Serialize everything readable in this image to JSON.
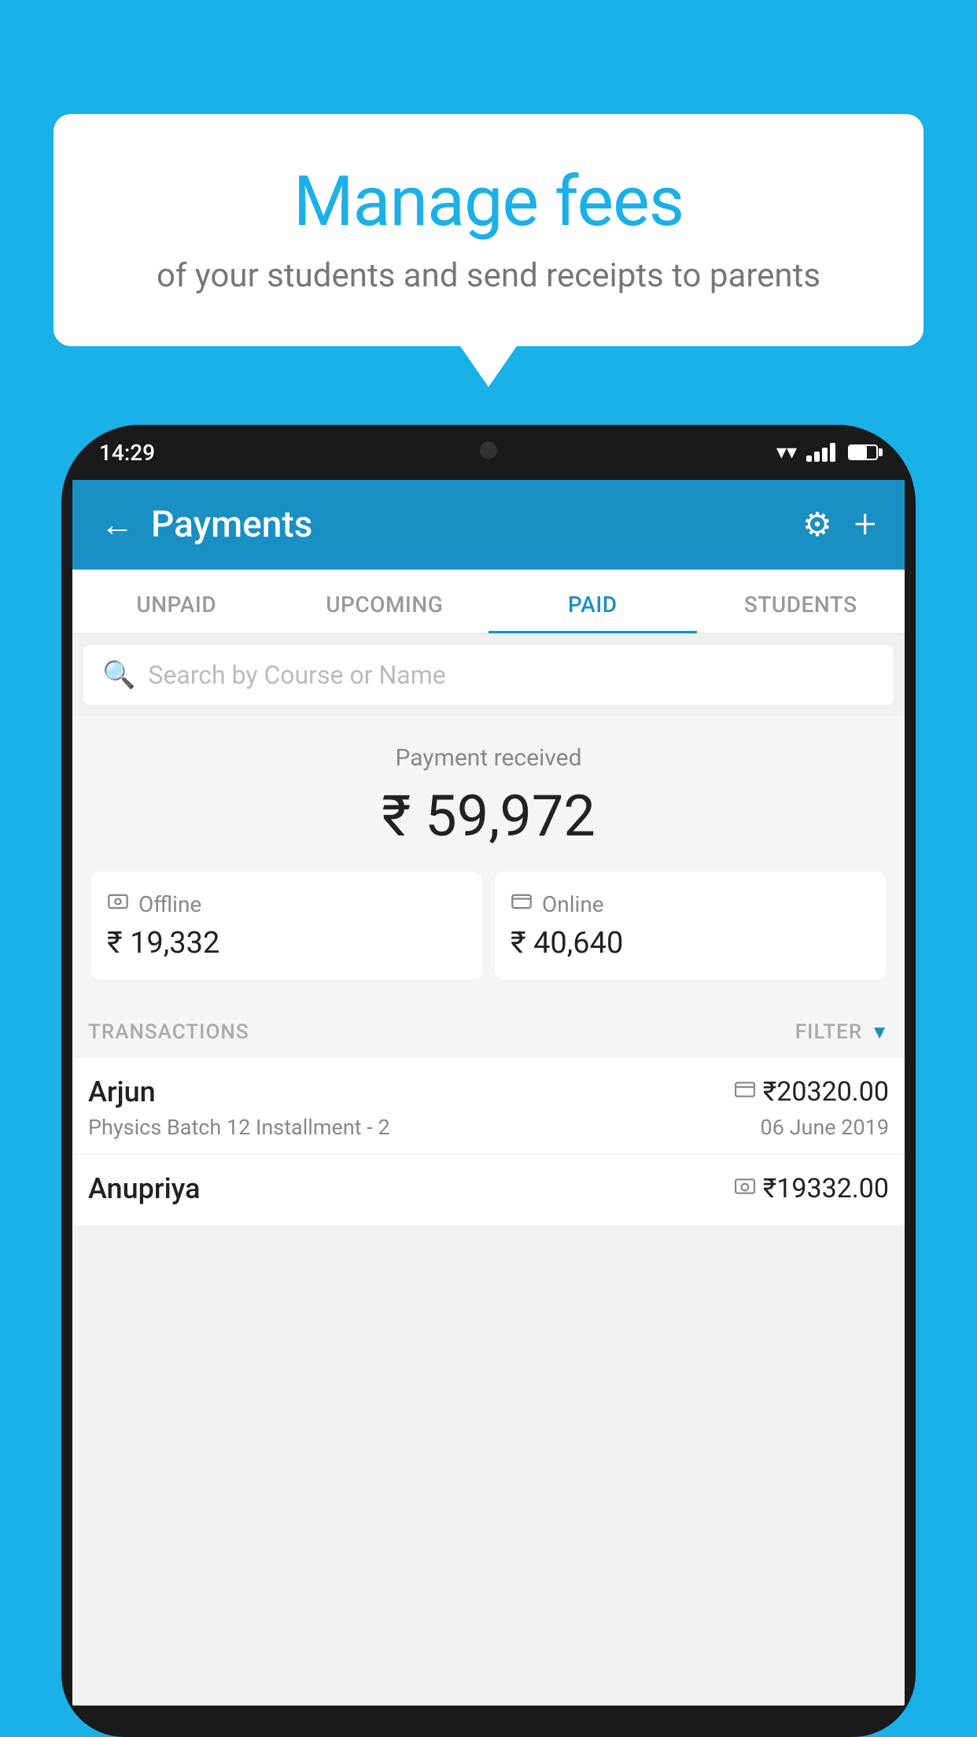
{
  "background_color": "#1ab0e8",
  "bubble": {
    "title": "Manage fees",
    "subtitle": "of your students and send receipts to parents"
  },
  "phone": {
    "status_bar": {
      "time": "14:29"
    },
    "header": {
      "title": "Payments",
      "back_label": "←",
      "settings_label": "⚙",
      "add_label": "+"
    },
    "tabs": [
      {
        "label": "UNPAID",
        "active": false
      },
      {
        "label": "UPCOMING",
        "active": false
      },
      {
        "label": "PAID",
        "active": true
      },
      {
        "label": "STUDENTS",
        "active": false
      }
    ],
    "search": {
      "placeholder": "Search by Course or Name"
    },
    "payment_summary": {
      "label": "Payment received",
      "amount": "₹ 59,972",
      "offline": {
        "icon": "₹",
        "label": "Offline",
        "amount": "₹ 19,332"
      },
      "online": {
        "icon": "💳",
        "label": "Online",
        "amount": "₹ 40,640"
      }
    },
    "transactions": {
      "section_label": "TRANSACTIONS",
      "filter_label": "FILTER",
      "items": [
        {
          "name": "Arjun",
          "course": "Physics Batch 12 Installment - 2",
          "amount": "₹20320.00",
          "date": "06 June 2019",
          "payment_type": "online"
        },
        {
          "name": "Anupriya",
          "course": "",
          "amount": "₹19332.00",
          "date": "",
          "payment_type": "offline"
        }
      ]
    }
  }
}
